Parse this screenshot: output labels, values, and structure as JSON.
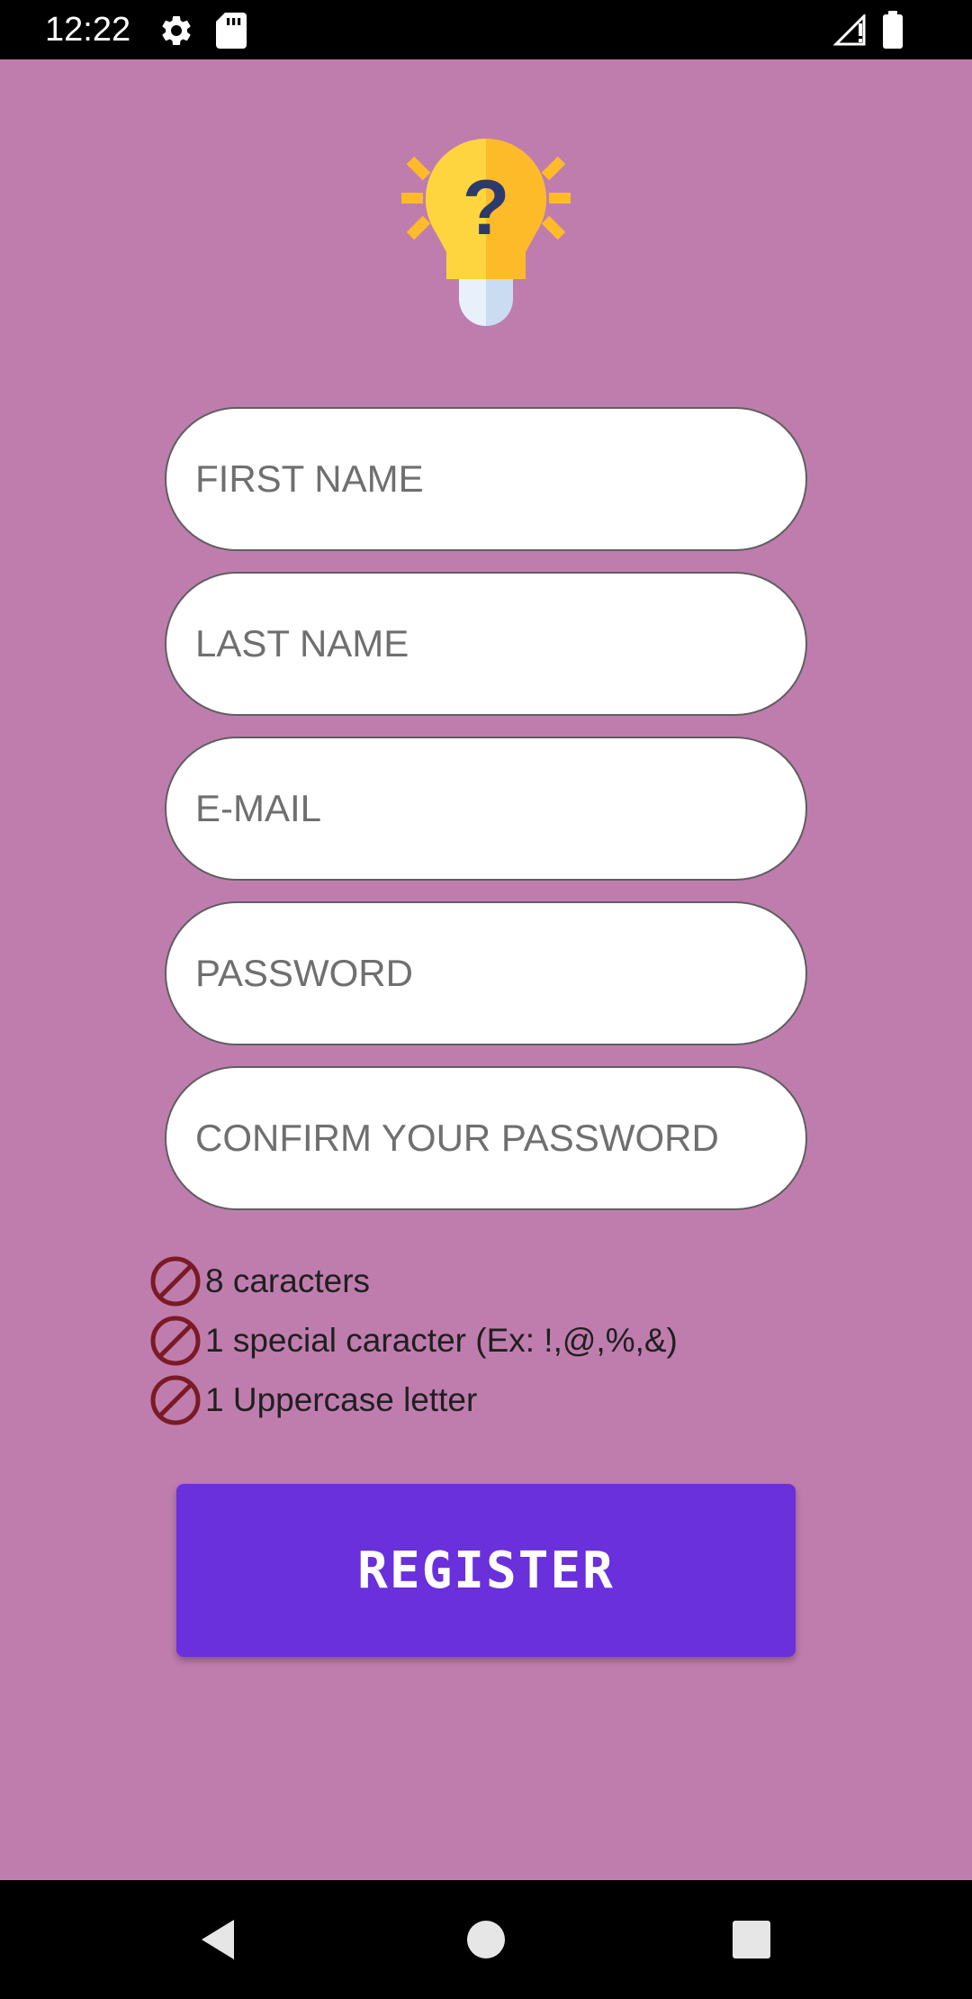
{
  "status_bar": {
    "time": "12:22",
    "icons": [
      "settings-icon",
      "sd-card-icon",
      "signal-icon",
      "battery-icon"
    ]
  },
  "logo": {
    "icon": "lightbulb-question-icon"
  },
  "form": {
    "first_name": {
      "placeholder": "FIRST NAME",
      "value": ""
    },
    "last_name": {
      "placeholder": "LAST NAME",
      "value": ""
    },
    "email": {
      "placeholder": "E-MAIL",
      "value": ""
    },
    "password": {
      "placeholder": "PASSWORD",
      "value": ""
    },
    "confirm_password": {
      "placeholder": "CONFIRM YOUR PASSWORD",
      "value": ""
    }
  },
  "password_rules": [
    {
      "text": "8 caracters",
      "icon": "forbidden-icon"
    },
    {
      "text": "1 special caracter (Ex: !,@,%,&)",
      "icon": "forbidden-icon"
    },
    {
      "text": "1 Uppercase letter",
      "icon": "forbidden-icon"
    }
  ],
  "register_button": {
    "label": "REGISTER"
  },
  "nav_bar": {
    "icons": [
      "back-icon",
      "home-icon",
      "recents-icon"
    ]
  },
  "colors": {
    "background": "#BF7DAE",
    "button": "#6930DC",
    "rule_icon": "#7A1A24",
    "bulb_yellow": "#FFD53F",
    "bulb_orange": "#FDBB2A"
  }
}
